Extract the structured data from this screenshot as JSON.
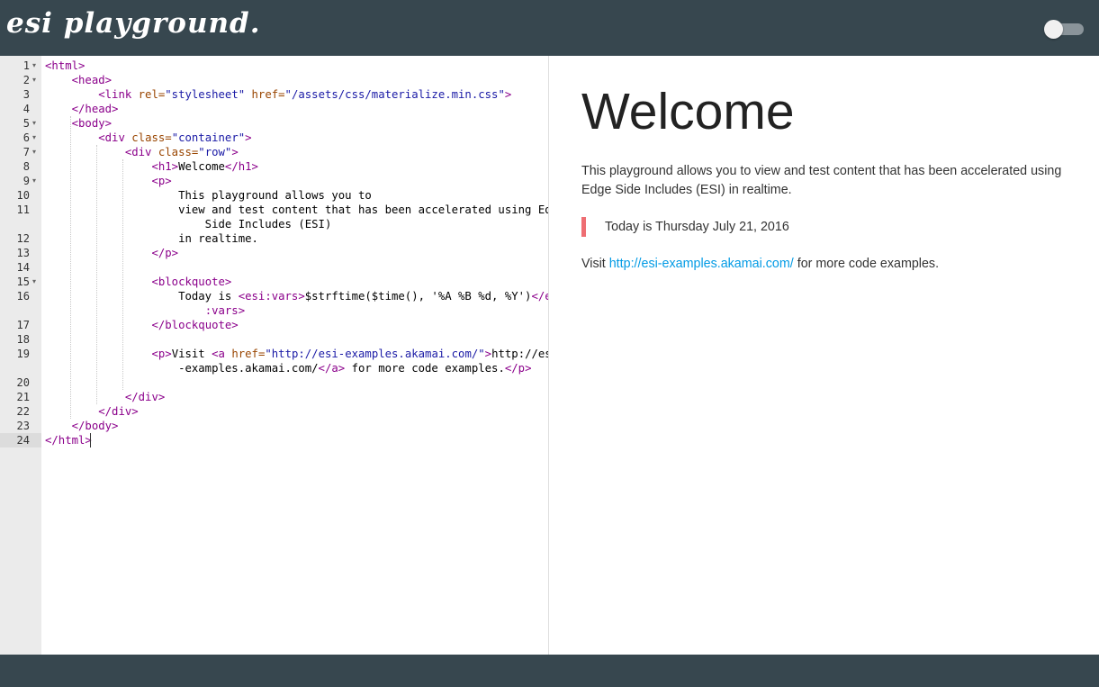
{
  "app": {
    "logo": "esi playground."
  },
  "editor": {
    "gutter": [
      {
        "num": "1",
        "fold": true
      },
      {
        "num": "2",
        "fold": true
      },
      {
        "num": "3",
        "fold": false
      },
      {
        "num": "4",
        "fold": false
      },
      {
        "num": "5",
        "fold": true
      },
      {
        "num": "6",
        "fold": true
      },
      {
        "num": "7",
        "fold": true
      },
      {
        "num": "8",
        "fold": false
      },
      {
        "num": "9",
        "fold": true
      },
      {
        "num": "10",
        "fold": false
      },
      {
        "num": "11",
        "fold": false
      },
      {
        "num": "12",
        "fold": false
      },
      {
        "num": "13",
        "fold": false
      },
      {
        "num": "14",
        "fold": false
      },
      {
        "num": "15",
        "fold": true
      },
      {
        "num": "16",
        "fold": false
      },
      {
        "num": "17",
        "fold": false
      },
      {
        "num": "18",
        "fold": false
      },
      {
        "num": "19",
        "fold": false
      },
      {
        "num": "20",
        "fold": false
      },
      {
        "num": "21",
        "fold": false
      },
      {
        "num": "22",
        "fold": false
      },
      {
        "num": "23",
        "fold": false
      },
      {
        "num": "24",
        "fold": false
      }
    ],
    "active_line": "24",
    "code_lines": [
      [
        [
          "tag",
          "<html>"
        ]
      ],
      [
        [
          "",
          "    "
        ],
        [
          "tag",
          "<head>"
        ]
      ],
      [
        [
          "",
          "        "
        ],
        [
          "tag",
          "<link "
        ],
        [
          "attr",
          "rel="
        ],
        [
          "str",
          "\"stylesheet\""
        ],
        [
          "attr",
          " href="
        ],
        [
          "str",
          "\"/assets/css/materialize.min.css\""
        ],
        [
          "tag",
          ">"
        ]
      ],
      [
        [
          "",
          "    "
        ],
        [
          "tag",
          "</head>"
        ]
      ],
      [
        [
          "",
          "    "
        ],
        [
          "tag",
          "<body>"
        ]
      ],
      [
        [
          "",
          "        "
        ],
        [
          "tag",
          "<div "
        ],
        [
          "attr",
          "class="
        ],
        [
          "str",
          "\"container\""
        ],
        [
          "tag",
          ">"
        ]
      ],
      [
        [
          "",
          "            "
        ],
        [
          "tag",
          "<div "
        ],
        [
          "attr",
          "class="
        ],
        [
          "str",
          "\"row\""
        ],
        [
          "tag",
          ">"
        ]
      ],
      [
        [
          "",
          "                "
        ],
        [
          "tag",
          "<h1>"
        ],
        [
          "",
          "Welcome"
        ],
        [
          "tag",
          "</h1>"
        ]
      ],
      [
        [
          "",
          "                "
        ],
        [
          "tag",
          "<p>"
        ]
      ],
      [
        [
          "",
          "                    This playground allows you to"
        ]
      ],
      [
        [
          "",
          "                    view and test content that has been accelerated using Edge"
        ]
      ],
      [
        [
          "",
          "                        Side Includes (ESI)"
        ]
      ],
      [
        [
          "",
          "                    in realtime."
        ]
      ],
      [
        [
          "",
          "                "
        ],
        [
          "tag",
          "</p>"
        ]
      ],
      [],
      [
        [
          "",
          "                "
        ],
        [
          "tag",
          "<blockquote>"
        ]
      ],
      [
        [
          "",
          "                    Today is "
        ],
        [
          "tag",
          "<esi:vars>"
        ],
        [
          "",
          "$strftime($time(), '%A %B %d, %Y')"
        ],
        [
          "tag",
          "</esi"
        ]
      ],
      [
        [
          "",
          "                        "
        ],
        [
          "tag",
          ":vars>"
        ]
      ],
      [
        [
          "",
          "                "
        ],
        [
          "tag",
          "</blockquote>"
        ]
      ],
      [],
      [
        [
          "",
          "                "
        ],
        [
          "tag",
          "<p>"
        ],
        [
          "",
          "Visit "
        ],
        [
          "tag",
          "<a "
        ],
        [
          "attr",
          "href="
        ],
        [
          "str",
          "\"http://esi-examples.akamai.com/\""
        ],
        [
          "tag",
          ">"
        ],
        [
          "",
          "http://esi"
        ]
      ],
      [
        [
          "",
          "                    -examples.akamai.com/"
        ],
        [
          "tag",
          "</a>"
        ],
        [
          "",
          " for more code examples."
        ],
        [
          "tag",
          "</p>"
        ]
      ],
      [],
      [
        [
          "",
          "            "
        ],
        [
          "tag",
          "</div>"
        ]
      ],
      [
        [
          "",
          "        "
        ],
        [
          "tag",
          "</div>"
        ]
      ],
      [
        [
          "",
          "    "
        ],
        [
          "tag",
          "</body>"
        ]
      ],
      [
        [
          "tag",
          "</html>"
        ]
      ]
    ]
  },
  "preview": {
    "heading": "Welcome",
    "paragraph": "This playground allows you to view and test content that has been accelerated using Edge Side Includes (ESI) in realtime.",
    "quote": "Today is Thursday July 21, 2016",
    "visit_prefix": "Visit ",
    "link_text": "http://esi-examples.akamai.com/",
    "visit_suffix": " for more code examples.",
    "accent_color": "#ee6e73",
    "link_color": "#039be5"
  },
  "theme": {
    "bar_color": "#37474f"
  }
}
